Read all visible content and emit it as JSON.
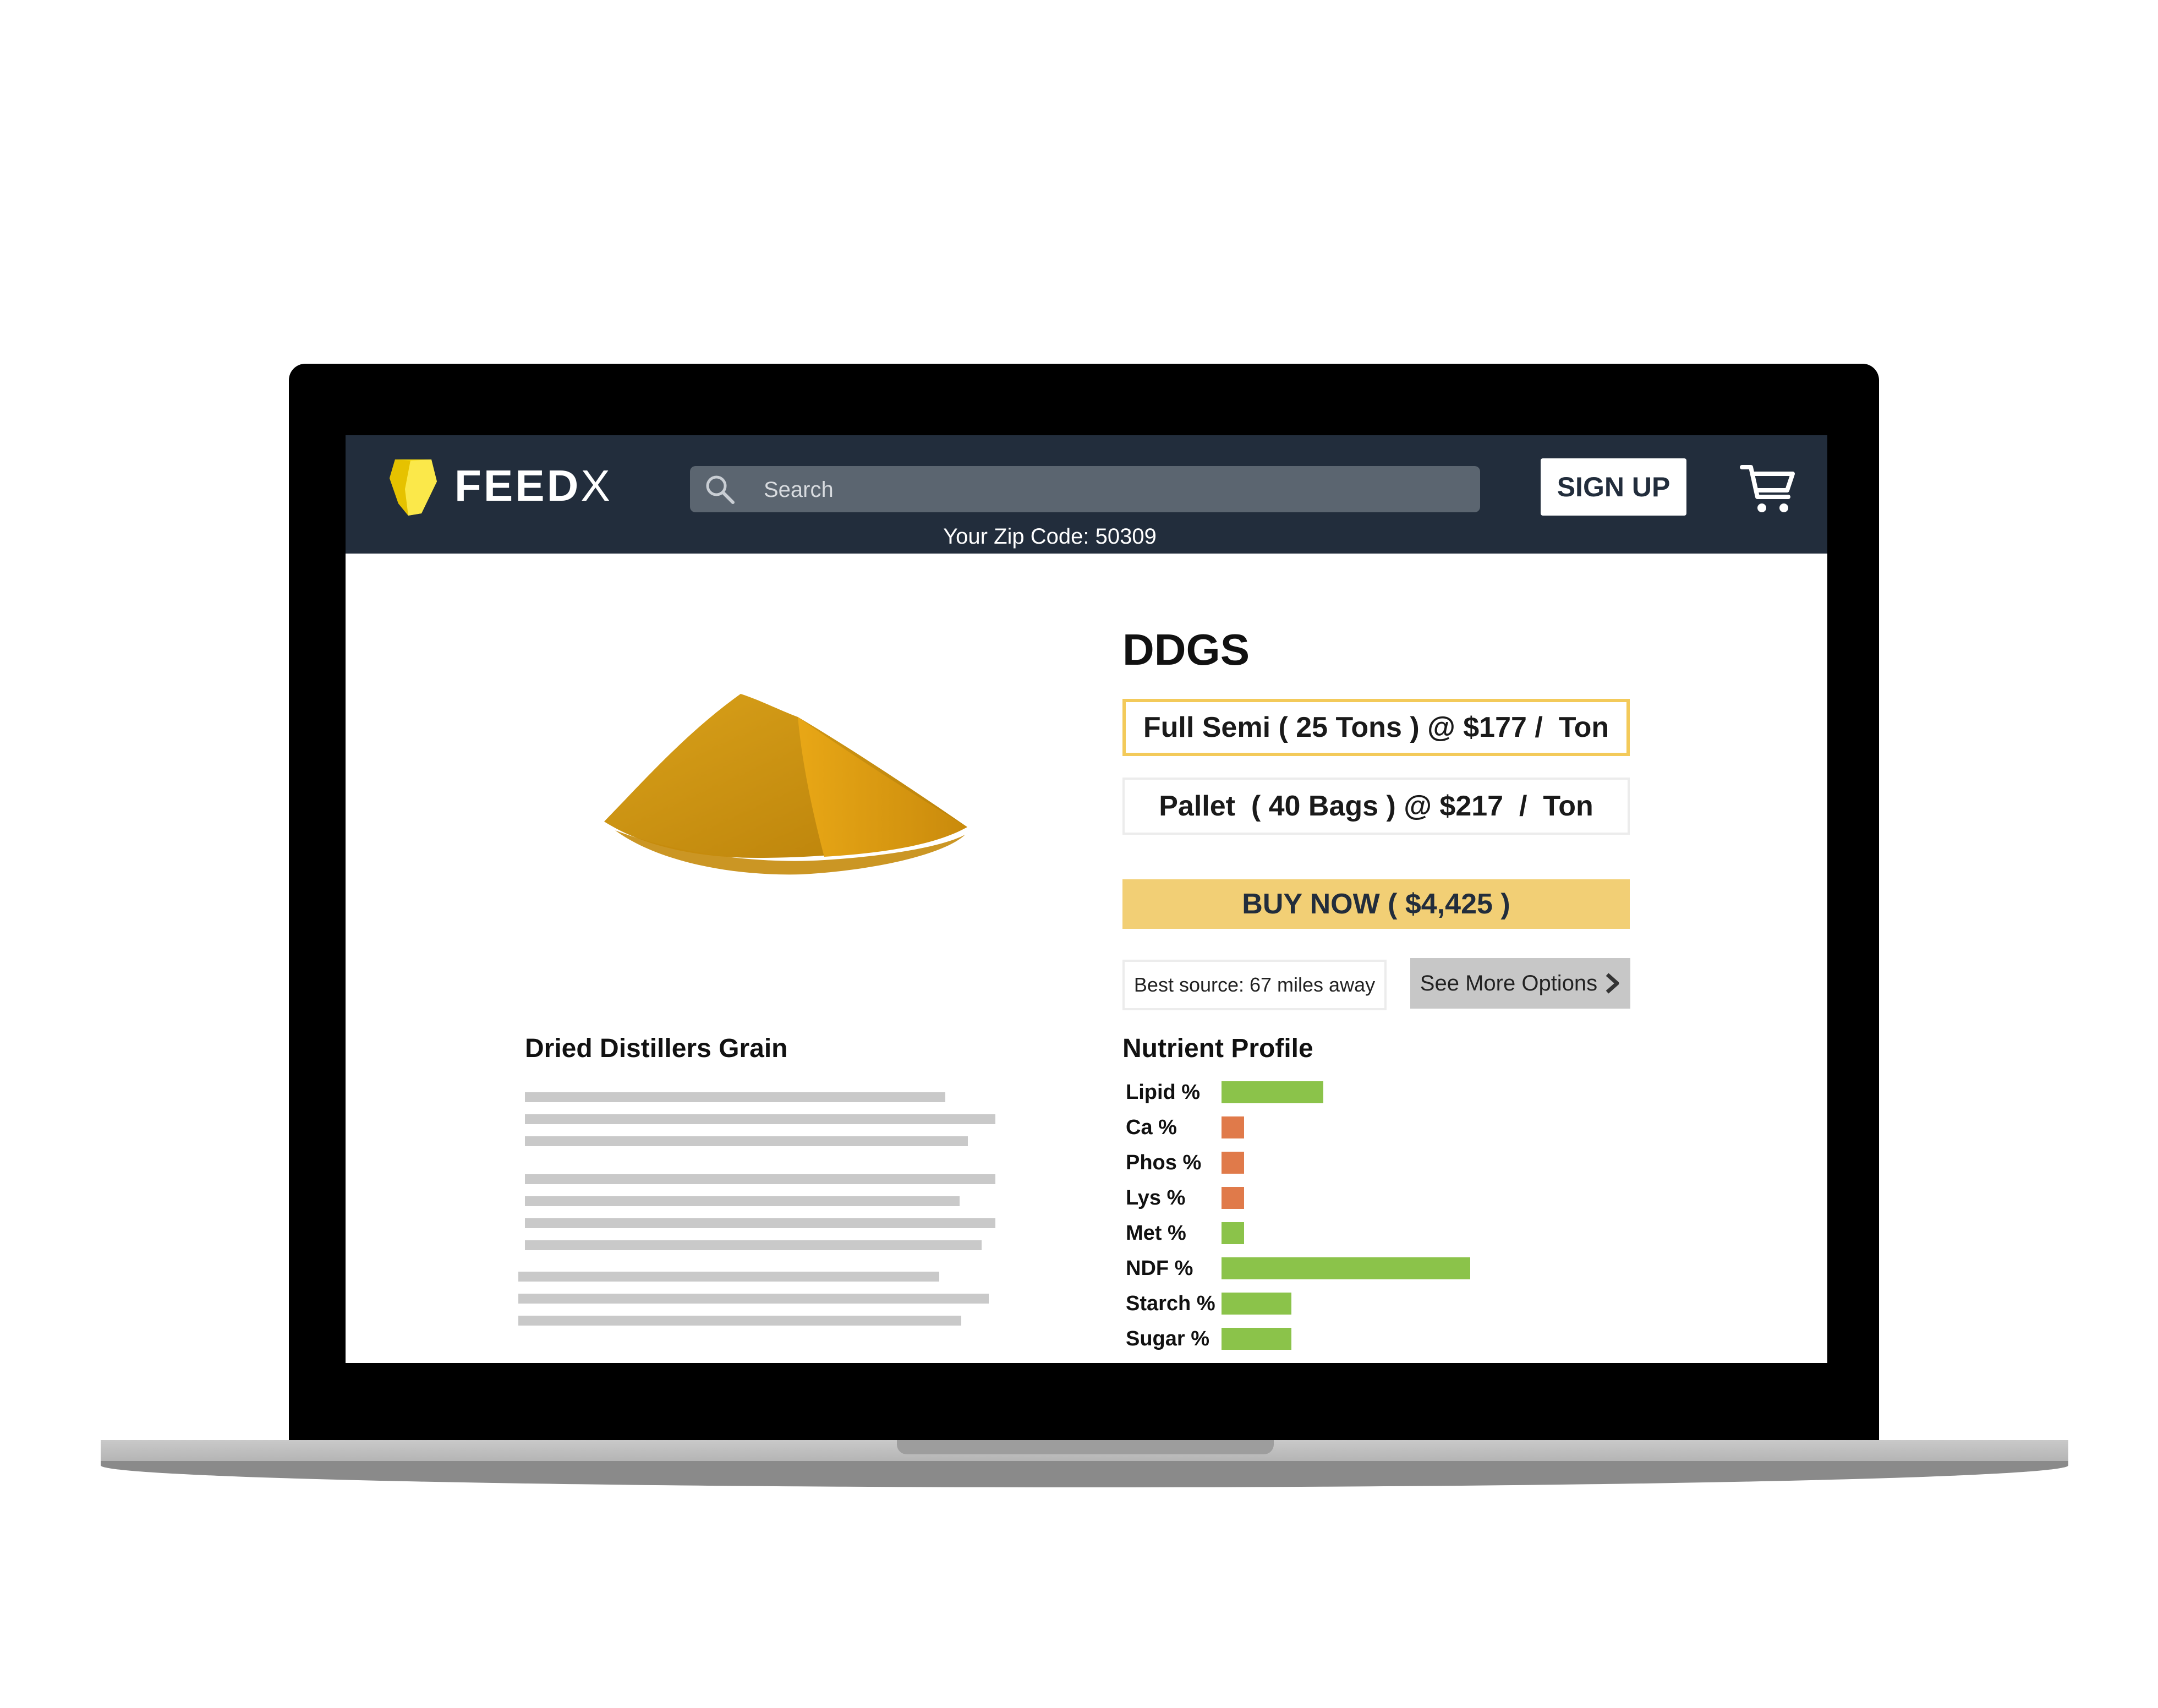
{
  "header": {
    "logo_text": "FEED",
    "logo_text_x": "X",
    "search_placeholder": "Search",
    "signup_label": "SIGN UP",
    "zip_text": "Your Zip Code: 50309"
  },
  "product": {
    "title": "DDGS",
    "options": [
      {
        "label": "Full Semi ( 25 Tons ) @ $177 /  Ton",
        "selected": true
      },
      {
        "label": "Pallet  ( 40 Bags ) @ $217  /  Ton",
        "selected": false
      }
    ],
    "buy_label": "BUY NOW ( $4,425 )",
    "best_source": "Best source: 67 miles away",
    "more_options_label": "See More Options",
    "description_heading": "Dried Distillers Grain"
  },
  "nutrient_profile": {
    "heading": "Nutrient Profile",
    "items": [
      {
        "label": "Lipid %",
        "level": 0.41,
        "color": "#8bc34a"
      },
      {
        "label": "Ca %",
        "level": 0.09,
        "color": "#e07a4a"
      },
      {
        "label": "Phos %",
        "level": 0.09,
        "color": "#e07a4a"
      },
      {
        "label": "Lys %",
        "level": 0.09,
        "color": "#e07a4a"
      },
      {
        "label": "Met %",
        "level": 0.09,
        "color": "#8bc34a"
      },
      {
        "label": "NDF %",
        "level": 1.0,
        "color": "#8bc34a"
      },
      {
        "label": "Starch %",
        "level": 0.28,
        "color": "#8bc34a"
      },
      {
        "label": "Sugar %",
        "level": 0.28,
        "color": "#8bc34a"
      }
    ]
  },
  "colors": {
    "header_bg": "#222d3c",
    "logo_yellow": "#f5d90a",
    "selected_border": "#f3ca5a",
    "buy_bg": "#f2cf75"
  },
  "icons": {
    "logo": "lemon-logo-icon",
    "search": "search-icon",
    "cart": "cart-icon",
    "chevron": "chevron-right-icon"
  }
}
